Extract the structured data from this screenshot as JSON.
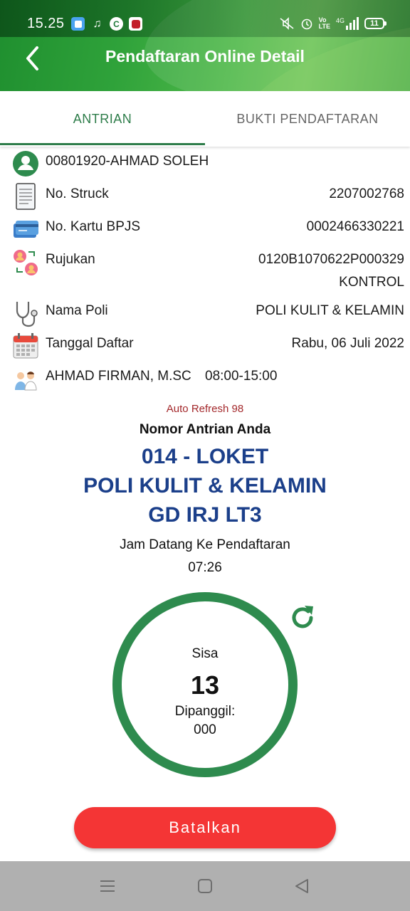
{
  "status_bar": {
    "time": "15.25",
    "app_icons": [
      "square-app-icon",
      "tiktok-icon",
      "c-app-icon",
      "hexagon-app-icon"
    ],
    "right_icons": [
      "mute-icon",
      "alarm-icon",
      "volte-icon",
      "signal-4g-icon"
    ],
    "network": "4G",
    "battery": "11"
  },
  "header": {
    "title": "Pendaftaran Online Detail",
    "back_icon": "chevron-left-icon"
  },
  "tabs": [
    {
      "label": "ANTRIAN",
      "active": true
    },
    {
      "label": "BUKTI PENDAFTARAN",
      "active": false
    }
  ],
  "patient": {
    "name": "00801920-AHMAD SOLEH",
    "icon": "person-avatar-icon"
  },
  "details": {
    "struck": {
      "label": "No. Struck",
      "value": "2207002768",
      "icon": "receipt-icon"
    },
    "bpjs": {
      "label": "No. Kartu BPJS",
      "value": "0002466330221",
      "icon": "card-icon"
    },
    "rujukan": {
      "label": "Rujukan",
      "value": "0120B1070622P000329",
      "value2": "KONTROL",
      "icon": "referral-icon"
    },
    "poli": {
      "label": "Nama Poli",
      "value": "POLI KULIT & KELAMIN",
      "icon": "stethoscope-icon"
    },
    "tanggal": {
      "label": "Tanggal Daftar",
      "value": "Rabu, 06 Juli 2022",
      "icon": "calendar-icon"
    },
    "dokter": {
      "name": "AHMAD FIRMAN, M.SC",
      "time": "08:00-15:00",
      "icon": "doctors-icon"
    }
  },
  "queue": {
    "auto_refresh": "Auto Refresh 98",
    "nomor_label": "Nomor Antrian Anda",
    "line1": "014 - LOKET",
    "line2": "POLI KULIT & KELAMIN",
    "line3": "GD IRJ LT3",
    "jam_label": "Jam Datang Ke Pendaftaran",
    "jam_value": "07:26",
    "sisa_label": "Sisa",
    "sisa_value": "13",
    "dipanggil_label": "Dipanggil:",
    "dipanggil_value": "000"
  },
  "actions": {
    "cancel": "Batalkan",
    "refresh_icon": "refresh-icon"
  },
  "colors": {
    "primary_green": "#2e8b4e",
    "queue_blue": "#1b3f8a",
    "cancel_red": "#f43535",
    "refresh_red_text": "#a3282b"
  },
  "nav": [
    "menu-icon",
    "home-icon",
    "back-triangle-icon"
  ]
}
